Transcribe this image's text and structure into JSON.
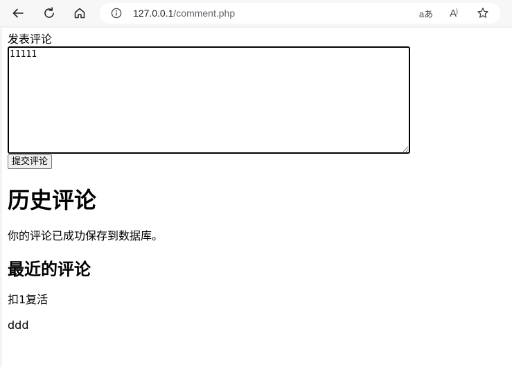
{
  "browser": {
    "url_host": "127.0.0.1",
    "url_path": "/comment.php",
    "read_aloud_label": "A",
    "translate_label": "aあ"
  },
  "form": {
    "label": "发表评论",
    "textarea_value": "11111",
    "submit_label": "提交评论"
  },
  "history": {
    "title": "历史评论",
    "status_message": "你的评论已成功保存到数据库。",
    "recent_title": "最近的评论",
    "comments": [
      "扣1复活",
      "ddd"
    ]
  }
}
